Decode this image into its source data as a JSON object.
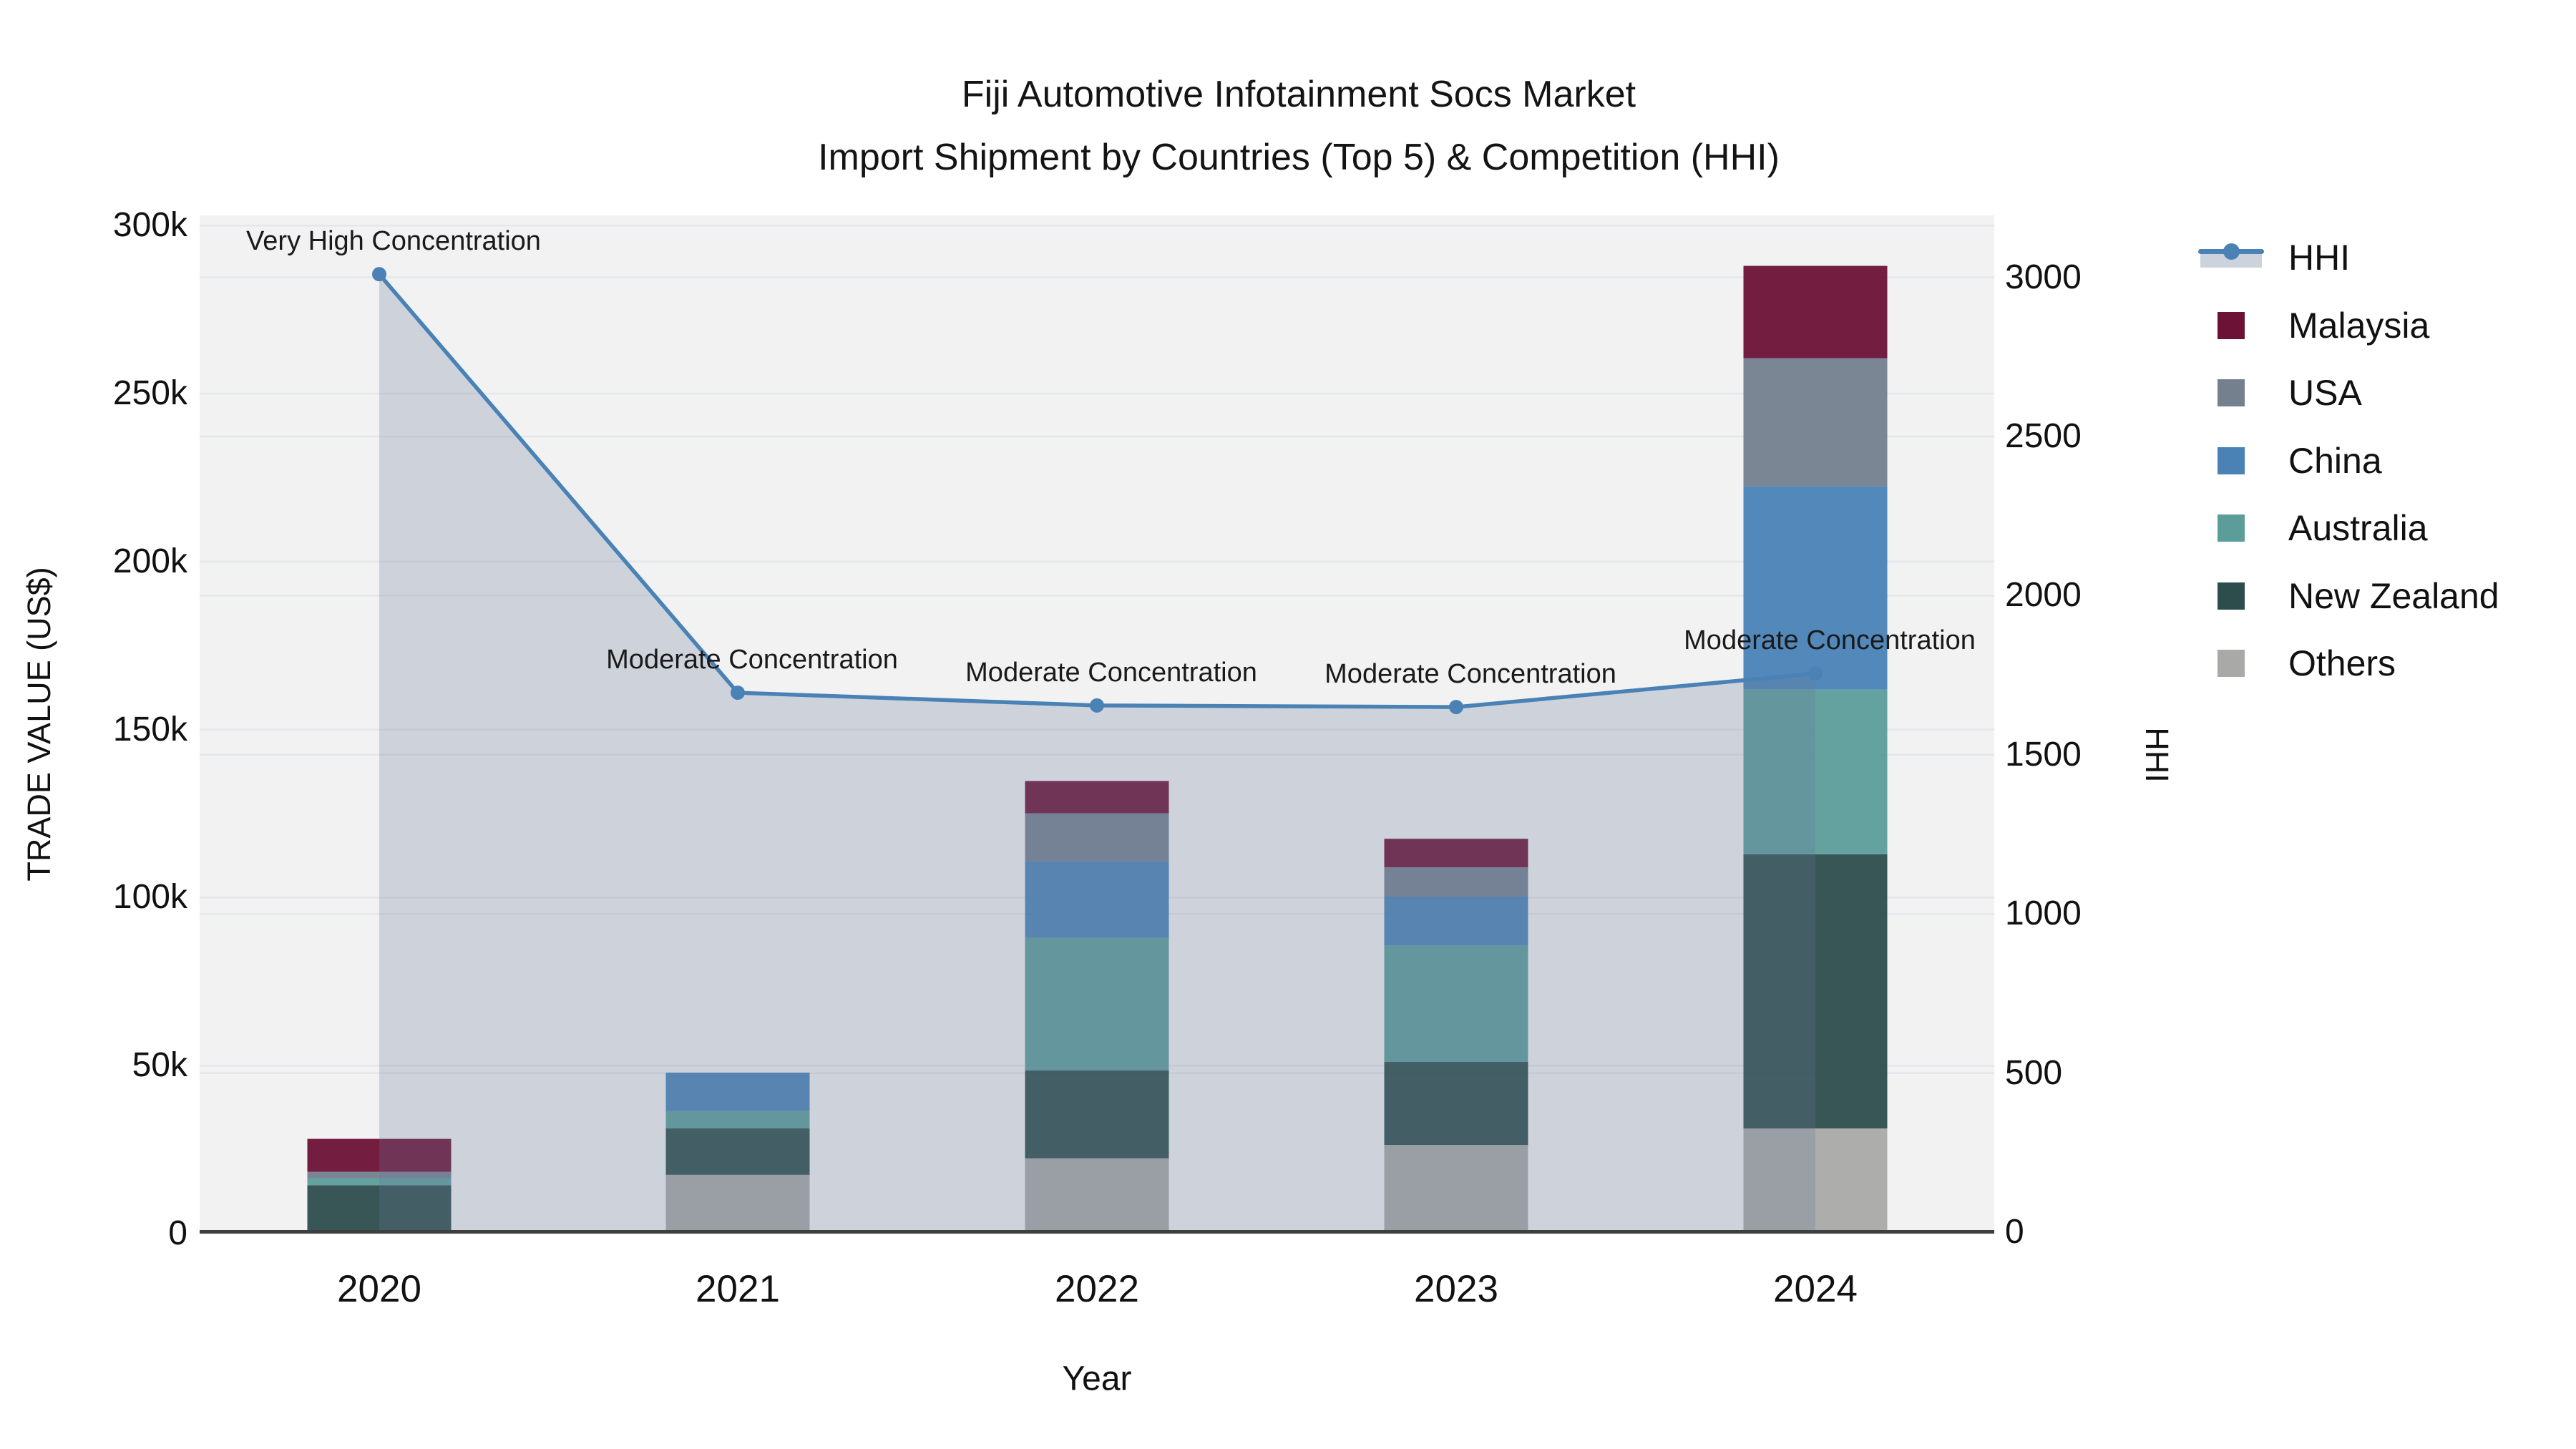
{
  "title": {
    "line1": "Fiji Automotive Infotainment Socs Market",
    "line2": "Import Shipment by Countries (Top 5) & Competition (HHI)"
  },
  "axes": {
    "left_title": "TRADE VALUE (US$)",
    "right_title": "HHI",
    "x_title": "Year",
    "left_tick_labels": [
      "0",
      "50k",
      "100k",
      "150k",
      "200k",
      "250k",
      "300k"
    ],
    "left_tick_values": [
      0,
      50000,
      100000,
      150000,
      200000,
      250000,
      300000
    ],
    "right_tick_labels": [
      "0",
      "500",
      "1000",
      "1500",
      "2000",
      "2500",
      "3000"
    ],
    "right_tick_values": [
      0,
      500,
      1000,
      1500,
      2000,
      2500,
      3000
    ],
    "left_range": [
      0,
      303000
    ],
    "right_range": [
      0,
      3195
    ],
    "grid": true
  },
  "chart_data": {
    "type": "combo-stacked-bar-line",
    "categories": [
      "2020",
      "2021",
      "2022",
      "2023",
      "2024"
    ],
    "series": [
      {
        "name": "Others",
        "color": "#A9A9A7",
        "values": [
          0,
          17500,
          22400,
          26400,
          31300
        ]
      },
      {
        "name": "New Zealand",
        "color": "#2D4D4C",
        "values": [
          14400,
          13800,
          26200,
          24700,
          81600
        ]
      },
      {
        "name": "Australia",
        "color": "#5C9D9A",
        "values": [
          2100,
          5200,
          39400,
          34700,
          49000
        ]
      },
      {
        "name": "China",
        "color": "#4A82B6",
        "values": [
          0,
          11400,
          22800,
          14500,
          60500
        ]
      },
      {
        "name": "USA",
        "color": "#74808E",
        "values": [
          1900,
          0,
          14300,
          8700,
          38100
        ]
      },
      {
        "name": "Malaysia",
        "color": "#6B1236",
        "values": [
          9800,
          0,
          9600,
          8500,
          27500
        ]
      }
    ],
    "line_series": {
      "name": "HHI",
      "color": "#4A82B6",
      "fill_color": "rgba(100,120,150,0.25)",
      "values": [
        3010,
        1695,
        1655,
        1650,
        1755
      ]
    },
    "annotations": [
      {
        "category": "2020",
        "text": "Very High Concentration"
      },
      {
        "category": "2021",
        "text": "Moderate Concentration"
      },
      {
        "category": "2022",
        "text": "Moderate Concentration"
      },
      {
        "category": "2023",
        "text": "Moderate Concentration"
      },
      {
        "category": "2024",
        "text": "Moderate Concentration"
      }
    ],
    "legend_order": [
      "HHI",
      "Malaysia",
      "USA",
      "China",
      "Australia",
      "New Zealand",
      "Others"
    ],
    "legend_position": "right",
    "title": "Fiji Automotive Infotainment Socs Market — Import Shipment by Countries (Top 5) & Competition (HHI)",
    "xlabel": "Year",
    "ylabel": "TRADE VALUE (US$)",
    "y2label": "HHI"
  },
  "colors": {
    "plot_background": "#F2F2F2",
    "figure_background": "#FFFFFF",
    "gridline": "#E4E6E9",
    "axis_line": "#3F3F3F",
    "text": "#111111"
  }
}
